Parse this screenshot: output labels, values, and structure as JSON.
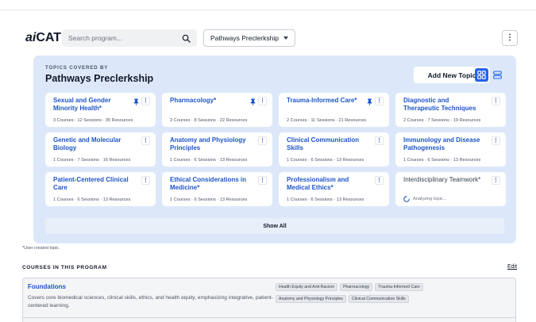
{
  "header": {
    "logo_ai": "ai",
    "logo_cat": "CAT",
    "search_placeholder": "Search program...",
    "program_select": "Pathways Preclerkship",
    "menu_glyph": "⋮"
  },
  "topics": {
    "subtitle": "TOPICS COVERED BY",
    "title": "Pathways Preclerkship",
    "add_button": "Add New Topic",
    "view_mode": "grid",
    "cards": [
      {
        "title": "Sexual and Gender Minority Health*",
        "meta": "3 Courses · 12 Sessions · 35 Resources",
        "pinned": true
      },
      {
        "title": "Pharmacology*",
        "meta": "3 Courses · 8 Sessions · 22 Resources",
        "pinned": true
      },
      {
        "title": "Trauma-Informed Care*",
        "meta": "2 Courses · 11 Sessions · 21 Resources",
        "pinned": true
      },
      {
        "title": "Diagnostic and Therapeutic Techniques",
        "meta": "2 Courses · 7 Sessions · 19 Resources",
        "pinned": false
      },
      {
        "title": "Genetic and Molecular Biology",
        "meta": "1 Courses · 7 Sessions · 16 Resources",
        "pinned": false
      },
      {
        "title": "Anatomy and Physiology Principles",
        "meta": "1 Courses · 6 Sessions · 13 Resources",
        "pinned": false
      },
      {
        "title": "Clinical Communication Skills",
        "meta": "1 Courses · 6 Sessions · 13 Resources",
        "pinned": false
      },
      {
        "title": "Immunology and Disease Pathogenesis",
        "meta": "1 Courses · 6 Sessions · 13 Resources",
        "pinned": false
      },
      {
        "title": "Patient-Centered Clinical Care",
        "meta": "1 Courses · 6 Sessions · 13 Resources",
        "pinned": false
      },
      {
        "title": "Ethical Considerations in Medicine*",
        "meta": "1 Courses · 6 Sessions · 13 Resources",
        "pinned": false
      },
      {
        "title": "Professionalism and Medical Ethics*",
        "meta": "1 Courses · 6 Sessions · 13 Resources",
        "pinned": false
      },
      {
        "title": "Interdisciplinary Teamwork*",
        "meta": "",
        "analyzing": "Analyzing topic...",
        "pinned": false
      }
    ],
    "show_all": "Show All"
  },
  "footnote": "*User created topic.",
  "courses": {
    "heading": "COURSES IN THIS PROGRAM",
    "edit": "Edit",
    "items": [
      {
        "title": "Foundations",
        "description": "Covers core biomedical sciences, clinical skills, ethics, and health equity, emphasizing integrative, patient-centered learning.",
        "tags": [
          "Health Equity and Anti-Racism",
          "Pharmacology",
          "Trauma-Informed Care",
          "Anatomy and Physiology Principles",
          "Clinical Communication Skills"
        ]
      }
    ]
  },
  "colors": {
    "accent": "#1d55c8",
    "panel_bg": "#dce8fa",
    "active_view": "#2563eb"
  }
}
